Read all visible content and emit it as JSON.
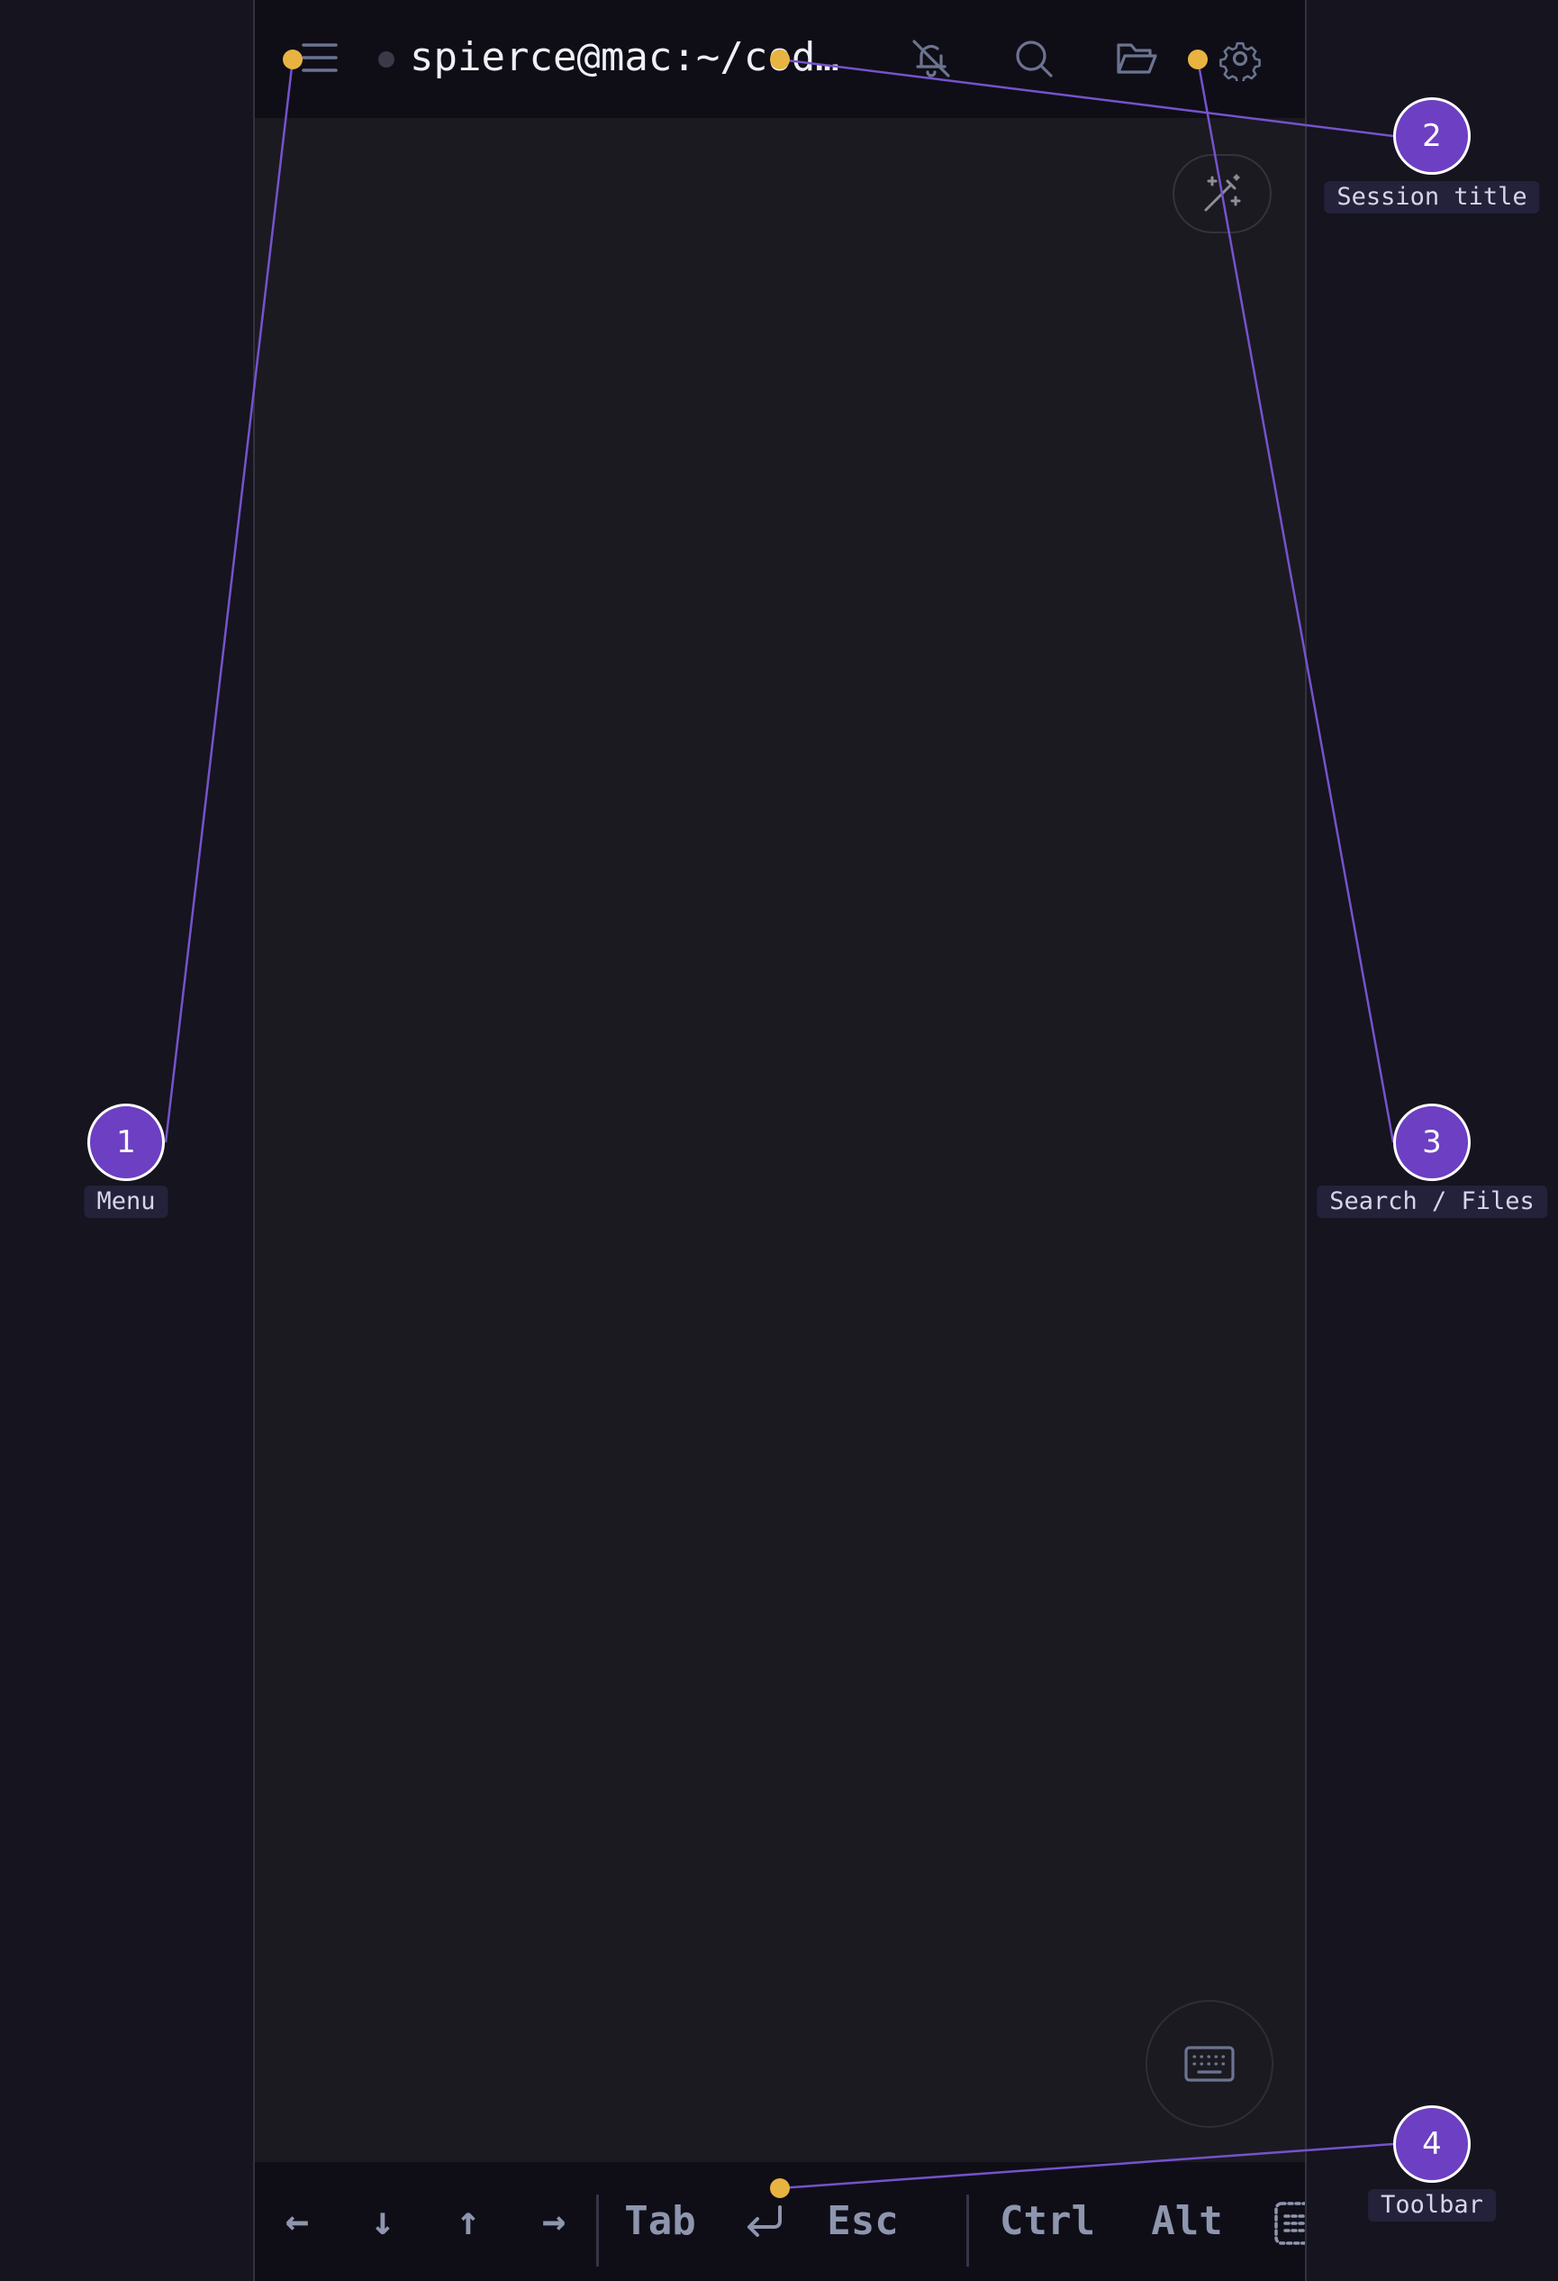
{
  "header": {
    "session_title": "spierce@mac:~/code…",
    "icons": [
      "menu-icon",
      "bell-off-icon",
      "search-icon",
      "folder-open-icon",
      "gear-icon"
    ]
  },
  "floating": {
    "magic_icon": "magic-wand-icon",
    "keyboard_icon": "keyboard-icon"
  },
  "toolbar": {
    "keys": {
      "left": "←",
      "down": "↓",
      "up": "↑",
      "right": "→",
      "tab": "Tab",
      "esc": "Esc",
      "ctrl": "Ctrl",
      "alt": "Alt"
    },
    "enter_icon": "enter-return-icon",
    "overflow_icon": "list-icon"
  },
  "callouts": [
    {
      "number": "1",
      "label": "Menu"
    },
    {
      "number": "2",
      "label": "Session title"
    },
    {
      "number": "3",
      "label": "Search / Files"
    },
    {
      "number": "4",
      "label": "Toolbar"
    }
  ],
  "colors": {
    "background": "#15141f",
    "terminal": "#1b1a21",
    "bar": "#0f0e17",
    "callout": "#6d3fc2",
    "anchor": "#e9b341",
    "icon": "#6b7490"
  }
}
